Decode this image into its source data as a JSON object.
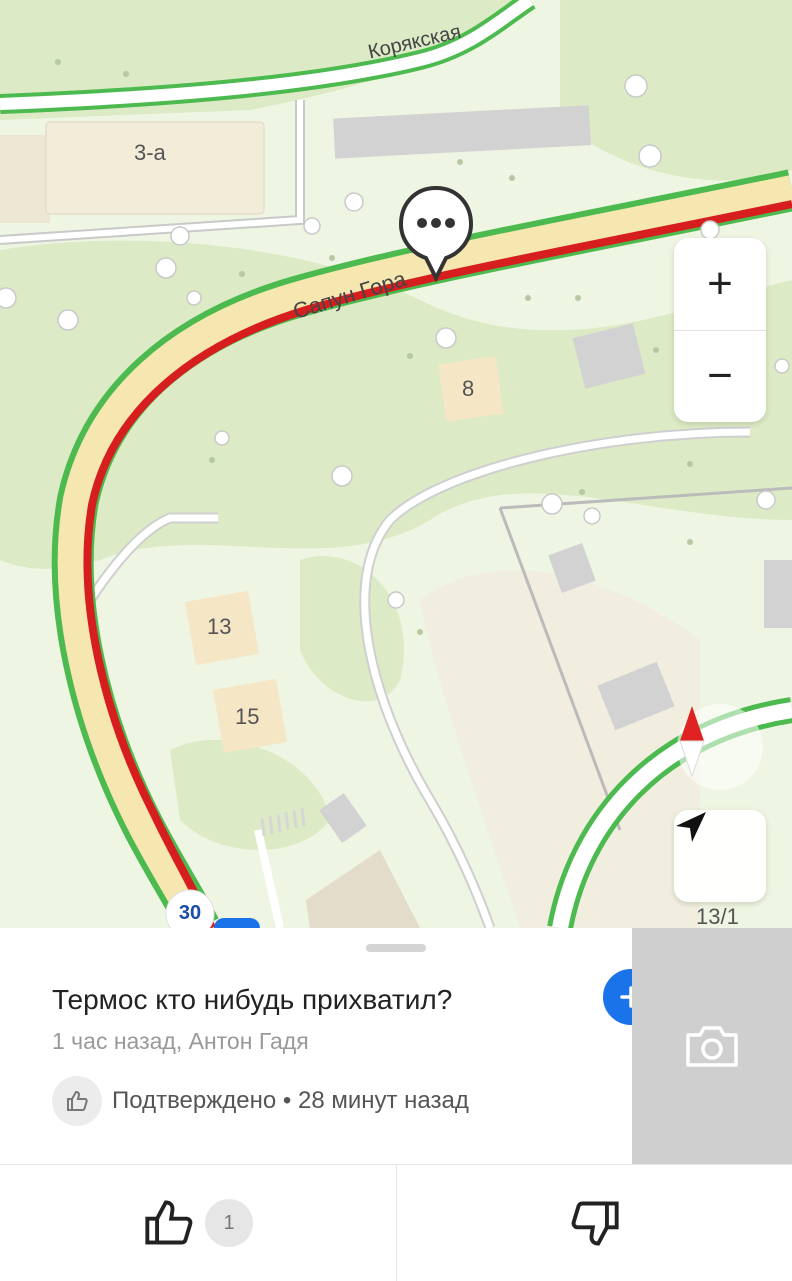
{
  "map": {
    "street_labels": [
      "Корякская",
      "Сапун Гора"
    ],
    "house_numbers": [
      "3-а",
      "8",
      "13",
      "15",
      "13/1"
    ],
    "speed_limit": "30",
    "colors": {
      "jam_red": "#d61e1e",
      "free_green": "#4cba4f",
      "road_fill": "#f6e6b0",
      "park": "#d9ecc0"
    },
    "controls": {
      "zoom_in": "+",
      "zoom_out": "−",
      "locate_icon": "navigation-arrow-icon",
      "compass_icon": "compass-icon"
    }
  },
  "event": {
    "title": "Термос кто нибудь прихватил?",
    "meta": "1 час назад, Антон Гадя",
    "confirm_text": "Подтверждено • 28 минут назад",
    "add_icon": "plus-icon",
    "photo_icon": "camera-icon"
  },
  "votes": {
    "like_count": "1",
    "like_icon": "thumbs-up-icon",
    "dislike_icon": "thumbs-down-icon"
  },
  "accent": "#1a73e8"
}
